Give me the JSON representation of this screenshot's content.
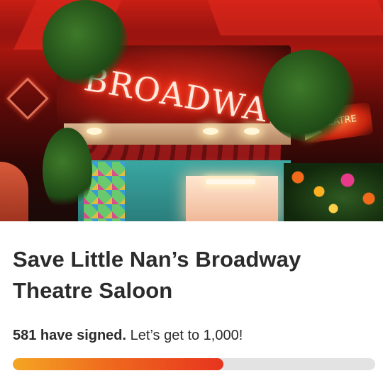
{
  "petition": {
    "title": "Save Little Nan’s Broadway Theatre Saloon",
    "signed_count_text": "581 have signed.",
    "goal_text": "Let’s get to 1,000!",
    "signatures": 581,
    "goal": 1000
  },
  "hero_image": {
    "sign_text": "BROADWAY",
    "small_sign_text": "THEATRE"
  },
  "colors": {
    "progress_start": "#f5a623",
    "progress_end": "#e7341e",
    "progress_track": "#e3e3e3",
    "text": "#2b2b2b"
  }
}
